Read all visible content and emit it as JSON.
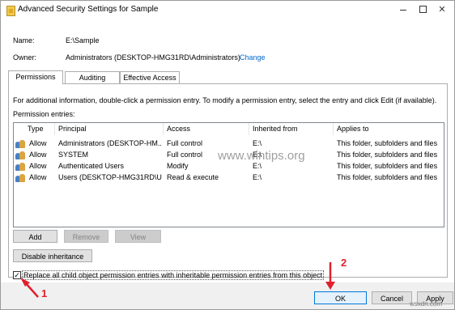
{
  "window": {
    "title": "Advanced Security Settings for Sample",
    "controls": {
      "minimize": "–",
      "maximize": "□",
      "close": "✕"
    }
  },
  "fields": {
    "name_label": "Name:",
    "name_value": "E:\\Sample",
    "owner_label": "Owner:",
    "owner_value": "Administrators (DESKTOP-HMG31RD\\Administrators)",
    "change_link": "Change"
  },
  "tabs": [
    {
      "label": "Permissions",
      "active": true
    },
    {
      "label": "Auditing",
      "active": false
    },
    {
      "label": "Effective Access",
      "active": false
    }
  ],
  "info_text": "For additional information, double-click a permission entry. To modify a permission entry, select the entry and click Edit (if available).",
  "entries_label": "Permission entries:",
  "table": {
    "columns": [
      "Type",
      "Principal",
      "Access",
      "Inherited from",
      "Applies to"
    ],
    "rows": [
      [
        "Allow",
        "Administrators (DESKTOP-HM...",
        "Full control",
        "E:\\",
        "This folder, subfolders and files"
      ],
      [
        "Allow",
        "SYSTEM",
        "Full control",
        "E:\\",
        "This folder, subfolders and files"
      ],
      [
        "Allow",
        "Authenticated Users",
        "Modify",
        "E:\\",
        "This folder, subfolders and files"
      ],
      [
        "Allow",
        "Users (DESKTOP-HMG31RD\\U...",
        "Read & execute",
        "E:\\",
        "This folder, subfolders and files"
      ]
    ]
  },
  "buttons": {
    "add": "Add",
    "remove": "Remove",
    "view": "View",
    "disable_inheritance": "Disable inheritance",
    "ok": "OK",
    "cancel": "Cancel",
    "apply": "Apply"
  },
  "replace_checkbox": {
    "checked": true,
    "label": "Replace all child object permission entries with inheritable permission entries from this object"
  },
  "annotations": {
    "step1": "1",
    "step2": "2",
    "color": "#e0202e"
  },
  "watermark": "www.wintips.org",
  "site_watermark": "wsxdn.com"
}
